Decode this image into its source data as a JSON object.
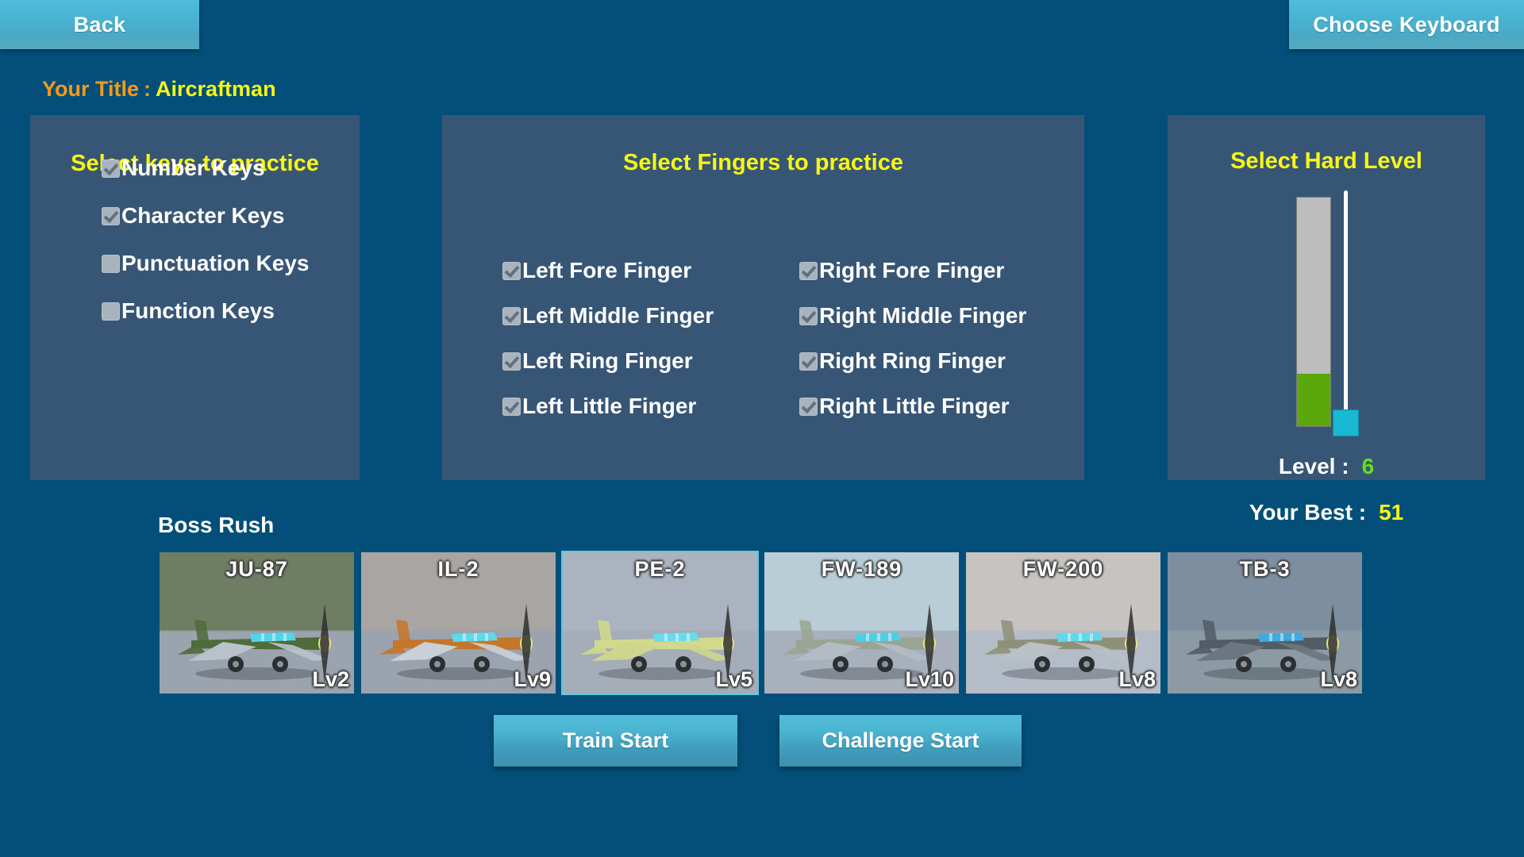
{
  "topbar": {
    "back_label": "Back",
    "choose_keyboard_label": "Choose Keyboard"
  },
  "title": {
    "label": "Your Title",
    "colon": ":",
    "value": "Aircraftman"
  },
  "keys_panel": {
    "heading": "Select keys to practice",
    "items": [
      {
        "label": "Number Keys",
        "checked": true
      },
      {
        "label": "Character Keys",
        "checked": true
      },
      {
        "label": "Punctuation Keys",
        "checked": false
      },
      {
        "label": "Function Keys",
        "checked": false
      }
    ]
  },
  "fingers_panel": {
    "heading": "Select Fingers to practice",
    "left": [
      {
        "label": "Left Fore Finger",
        "checked": true
      },
      {
        "label": "Left Middle Finger",
        "checked": true
      },
      {
        "label": "Left Ring Finger",
        "checked": true
      },
      {
        "label": "Left Little Finger",
        "checked": true
      }
    ],
    "right": [
      {
        "label": "Right Fore Finger",
        "checked": true
      },
      {
        "label": "Right Middle Finger",
        "checked": true
      },
      {
        "label": "Right Ring Finger",
        "checked": true
      },
      {
        "label": "Right Little Finger",
        "checked": true
      }
    ]
  },
  "level_panel": {
    "heading": "Select Hard Level",
    "level_label": "Level :",
    "level_value": "6",
    "slider_min": 1,
    "slider_max": 10,
    "slider_value": 6,
    "fill_percent": 23,
    "handle_percent": 23,
    "colors": {
      "bar_track": "#bdbdbd",
      "bar_fill": "#5aa80c",
      "handle": "#19b8d4",
      "level_value": "#66dd22"
    }
  },
  "best": {
    "label": "Your Best :",
    "value": "51"
  },
  "boss_rush": {
    "label": "Boss Rush",
    "cards": [
      {
        "name": "JU-87",
        "level": "Lv2",
        "selected": false,
        "sky": "#6f7d63",
        "ground": "#9aa3ae",
        "body": "#4f6b3a",
        "wing": "#b9c2cb",
        "canopy": "#4fd6e8"
      },
      {
        "name": "IL-2",
        "level": "Lv9",
        "selected": false,
        "sky": "#a8a5a3",
        "ground": "#9aa3ae",
        "body": "#c4762b",
        "wing": "#c9d0d6",
        "canopy": "#5fd8ea"
      },
      {
        "name": "PE-2",
        "level": "Lv5",
        "selected": true,
        "sky": "#aab3bf",
        "ground": "#a4adb8",
        "body": "#d2d98a",
        "wing": "#cdd58e",
        "canopy": "#67dcec"
      },
      {
        "name": "FW-189",
        "level": "Lv10",
        "selected": false,
        "sky": "#b8cdd6",
        "ground": "#a7b0bb",
        "body": "#9aa493",
        "wing": "#b3bcc4",
        "canopy": "#4fcfe6"
      },
      {
        "name": "FW-200",
        "level": "Lv8",
        "selected": false,
        "sky": "#c6c3c0",
        "ground": "#b3bcc7",
        "body": "#8e9178",
        "wing": "#b9c0c6",
        "canopy": "#5fd8ea"
      },
      {
        "name": "TB-3",
        "level": "Lv8",
        "selected": false,
        "sky": "#7d8ea0",
        "ground": "#8c9aa3",
        "body": "#525c66",
        "wing": "#6c7680",
        "canopy": "#3fa9e0"
      }
    ]
  },
  "actions": {
    "train_start_label": "Train Start",
    "challenge_start_label": "Challenge Start"
  }
}
